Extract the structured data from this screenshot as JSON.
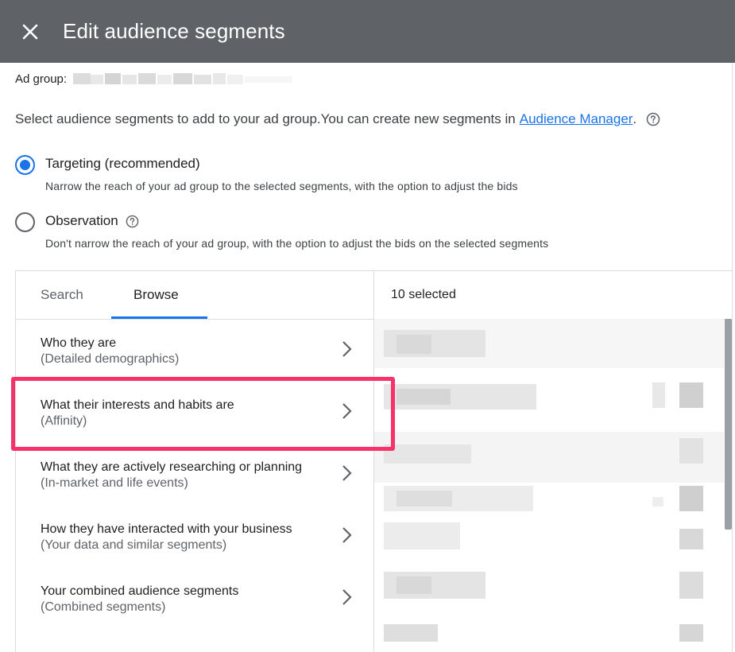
{
  "header": {
    "title": "Edit audience segments"
  },
  "ad_group": {
    "label": "Ad group:"
  },
  "description": {
    "text": "Select audience segments to add to your ad group.You can create new segments in",
    "link": "Audience Manager",
    "suffix": "."
  },
  "targeting_options": [
    {
      "label": "Targeting (recommended)",
      "description": "Narrow the reach of your ad group to the selected segments, with the option to adjust the bids",
      "checked": true
    },
    {
      "label": "Observation",
      "description": "Don't narrow the reach of your ad group, with the option to adjust the bids on the selected segments",
      "checked": false
    }
  ],
  "tabs": [
    {
      "label": "Search",
      "active": false
    },
    {
      "label": "Browse",
      "active": true
    }
  ],
  "selected": {
    "count_label": "10 selected"
  },
  "browse_items": [
    {
      "title": "Who they are",
      "subtitle": "(Detailed demographics)"
    },
    {
      "title": "What their interests and habits are",
      "subtitle": "(Affinity)",
      "highlighted": true
    },
    {
      "title": "What they are actively researching or planning",
      "subtitle": "(In-market and life events)"
    },
    {
      "title": "How they have interacted with your business",
      "subtitle": "(Your data and similar segments)"
    },
    {
      "title": "Your combined audience segments",
      "subtitle": "(Combined segments)"
    }
  ],
  "colors": {
    "header_bg": "#5f6368",
    "accent": "#1a73e8",
    "highlight": "#f7326b"
  },
  "icons": {
    "close": "close-icon",
    "help": "help-circle-icon",
    "chevron": "chevron-right-icon"
  }
}
